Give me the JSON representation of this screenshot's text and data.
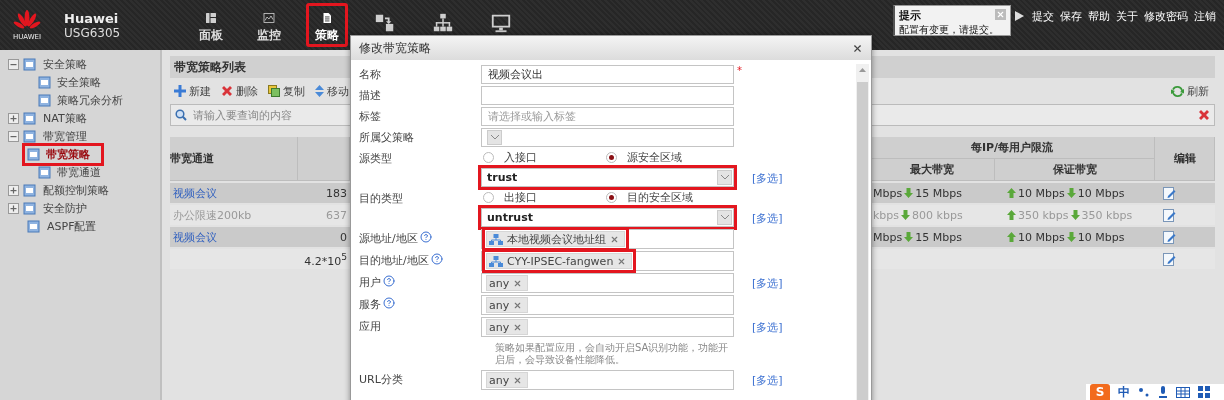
{
  "header": {
    "brand": "HUAWEI",
    "product": "Huawei",
    "model": "USG6305",
    "nav": [
      {
        "label": "面板",
        "selected": false,
        "highlighted": false
      },
      {
        "label": "监控",
        "selected": false,
        "highlighted": false
      },
      {
        "label": "策略",
        "selected": true,
        "highlighted": true
      },
      {
        "selected": false,
        "highlighted": false
      },
      {
        "selected": false,
        "highlighted": false
      },
      {
        "selected": false,
        "highlighted": false
      }
    ],
    "notice": {
      "title": "提示",
      "message": "配置有变更，请提交。"
    },
    "links": [
      "提交",
      "保存",
      "帮助",
      "关于",
      "修改密码",
      "注销"
    ]
  },
  "sidebar": {
    "items": [
      {
        "kind": "group",
        "label": "安全策略",
        "expanded": true,
        "selected": false,
        "children": [
          {
            "label": "安全策略",
            "selected": false,
            "highlighted": false
          },
          {
            "label": "策略冗余分析",
            "selected": false,
            "highlighted": false
          }
        ]
      },
      {
        "kind": "group",
        "label": "NAT策略",
        "expanded": false,
        "selected": false
      },
      {
        "kind": "group",
        "label": "带宽管理",
        "expanded": true,
        "selected": false,
        "children": [
          {
            "label": "带宽策略",
            "selected": true,
            "highlighted": true
          },
          {
            "label": "带宽通道",
            "selected": false,
            "highlighted": false
          }
        ]
      },
      {
        "kind": "group",
        "label": "配额控制策略",
        "expanded": false,
        "selected": false
      },
      {
        "kind": "group",
        "label": "安全防护",
        "expanded": false,
        "selected": false
      },
      {
        "kind": "leaf",
        "label": "ASPF配置",
        "selected": false
      }
    ]
  },
  "list": {
    "title": "带宽策略列表",
    "toolbar": [
      {
        "kind": "add",
        "label": "新建"
      },
      {
        "kind": "delete",
        "label": "删除"
      },
      {
        "kind": "copy",
        "label": "复制"
      },
      {
        "kind": "move",
        "label": "移动"
      }
    ],
    "refresh": "刷新",
    "search": {
      "placeholder": "请输入要查询的内容"
    },
    "table": {
      "columns": {
        "channel": "带宽通道",
        "group": "每IP/每用户限流",
        "max": "最大带宽",
        "guaranteed": "保证带宽",
        "edit": "编辑"
      },
      "rows": [
        {
          "channel": "视频会议",
          "column_2": "183",
          "max_up": "Mbps",
          "max_down": "15 Mbps",
          "guar_up": "10 Mbps",
          "guar_down": "10 Mbps",
          "disabled": false
        },
        {
          "channel": "办公限速200kb",
          "column_2": "637",
          "max_up": "kbps",
          "max_down": "800 kbps",
          "guar_up": "350 kbps",
          "guar_down": "350 kbps",
          "disabled": true
        },
        {
          "channel": "视频会议",
          "column_2": "0",
          "max_up": "Mbps",
          "max_down": "15 Mbps",
          "guar_up": "10 Mbps",
          "guar_down": "10 Mbps",
          "disabled": false
        },
        {
          "column_2": "4.2*10$^{5}$",
          "disabled": false
        }
      ]
    }
  },
  "dialog": {
    "title": "修改带宽策略",
    "fields": [
      {
        "kind": "text",
        "label": "名称",
        "value": "视频会议出",
        "required_mark": "*"
      },
      {
        "kind": "text",
        "label": "描述"
      },
      {
        "kind": "text",
        "label": "标签",
        "placeholder": "请选择或输入标签"
      },
      {
        "kind": "select",
        "label": "所属父策略"
      },
      {
        "kind": "radio",
        "label": "源类型",
        "options": [
          {
            "label": "入接口",
            "selected": false
          },
          {
            "label": "源安全区域",
            "selected": true
          }
        ]
      },
      {
        "kind": "select",
        "value": "trust",
        "highlighted": true,
        "link": "[多选]"
      },
      {
        "kind": "radio",
        "label": "目的类型",
        "options": [
          {
            "label": "出接口",
            "selected": false
          },
          {
            "label": "目的安全区域",
            "selected": true
          }
        ]
      },
      {
        "kind": "select",
        "value": "untrust",
        "highlighted": true,
        "link": "[多选]"
      },
      {
        "kind": "tags",
        "label": "源地址/地区",
        "help": true,
        "highlighted": true,
        "tags": [
          {
            "kind": "address",
            "label": "本地视频会议地址组"
          }
        ]
      },
      {
        "kind": "tags",
        "label": "目的地址/地区",
        "help": true,
        "highlighted": true,
        "tags": [
          {
            "kind": "address",
            "label": "CYY-IPSEC-fangwen"
          }
        ]
      },
      {
        "kind": "tags",
        "label": "用户",
        "help": true,
        "tags": [
          {
            "kind": "plain",
            "label": "any"
          }
        ],
        "link": "[多选]"
      },
      {
        "kind": "tags",
        "label": "服务",
        "help": true,
        "tags": [
          {
            "kind": "plain",
            "label": "any"
          }
        ]
      },
      {
        "kind": "tags",
        "label": "应用",
        "tags": [
          {
            "kind": "plain",
            "label": "any"
          }
        ],
        "link": "[多选]",
        "note": "策略如果配置应用，会自动开启SA识别功能，功能开启后，会导致设备性能降低。"
      },
      {
        "kind": "tags",
        "label": "URL分类",
        "tags": [
          {
            "kind": "plain",
            "label": "any"
          }
        ],
        "link": "[多选]"
      }
    ]
  },
  "ime": {
    "logo": "S",
    "mode": "中"
  }
}
